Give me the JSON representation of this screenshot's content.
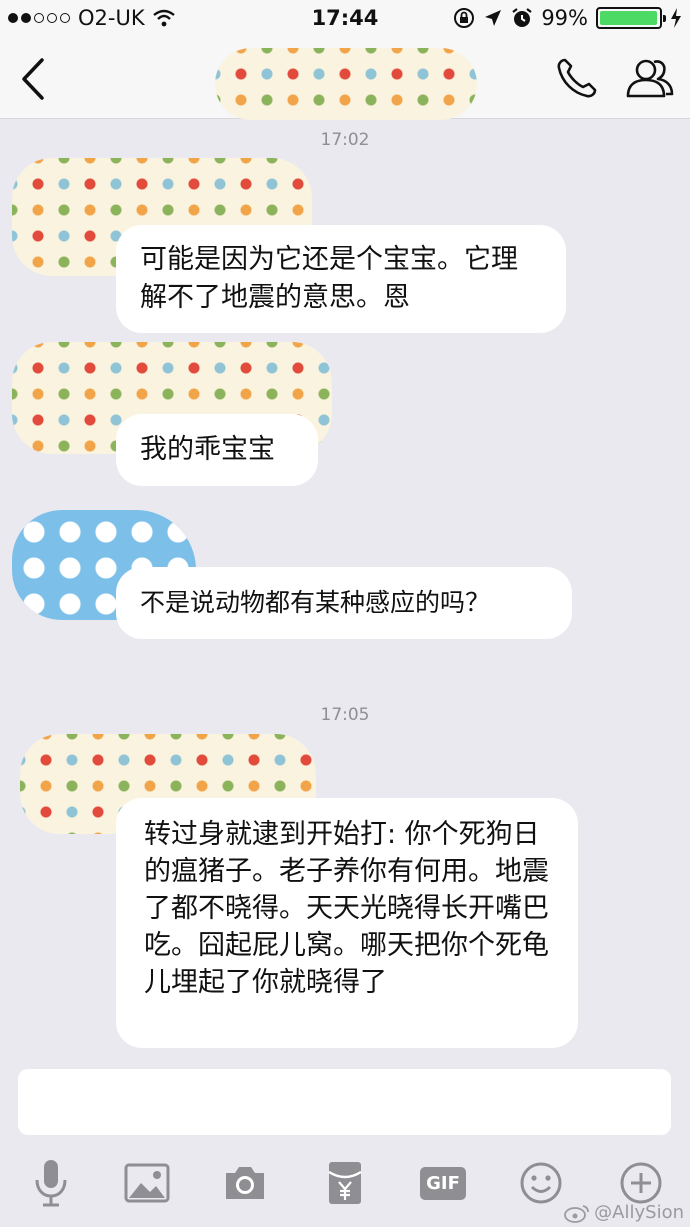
{
  "status_bar": {
    "carrier": "O2-UK",
    "signal_bars_filled": 2,
    "signal_bars_total": 5,
    "time": "17:44",
    "battery_percent": "99%",
    "battery_level": 0.99
  },
  "nav": {
    "back_icon": "chevron-left-icon",
    "call_icon": "phone-icon",
    "contact_icon": "people-icon"
  },
  "chat": {
    "timestamps": [
      "17:02",
      "17:05"
    ],
    "messages": [
      {
        "text": "可能是因为它还是个宝宝。它理解不了地震的意思。恩"
      },
      {
        "text": "我的乖宝宝"
      },
      {
        "text": "不是说动物都有某种感应的吗？"
      },
      {
        "text": "转过身就逮到开始打: 你个死狗日的瘟猪子。老子养你有何用。地震了都不晓得。天天光晓得长开嘴巴吃。囧起屁儿窝。哪天把你个死龟儿埋起了你就晓得了"
      }
    ]
  },
  "toolbar": {
    "gif_label": "GIF",
    "icons": [
      "microphone-icon",
      "image-icon",
      "camera-icon",
      "red-envelope-icon",
      "gif-icon",
      "emoji-icon",
      "plus-icon"
    ]
  },
  "watermark": "@AllySion",
  "colors": {
    "background": "#e9e9ef",
    "battery_green": "#4cd964",
    "icon_gray": "#8e8e93"
  }
}
